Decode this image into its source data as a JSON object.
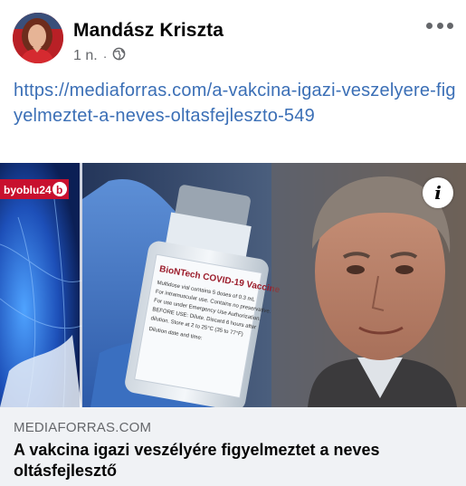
{
  "post": {
    "author": "Mandász Kriszta",
    "time": "1 n.",
    "separator": "·",
    "privacy_icon": "globe-icon",
    "link_text": "https://mediaforras.com/a-vakcina-igazi-veszelyere-figyelmeztet-a-neves-oltasfejleszto-549"
  },
  "link_preview": {
    "channel_logo": "byoblu24",
    "vial_label": [
      "BioNTech COVID-19 Vaccine",
      "Multidose vial contains 5 doses of 0.3 mL",
      "For intramuscular use. Contains no preservative.",
      "For use under Emergency Use Authorization.",
      "BEFORE USE: Dilute. Discard 6 hours after",
      "dilution. Store at 2 to 25°C (35 to 77°F)",
      "Dilution date and time:"
    ],
    "domain": "MEDIAFORRAS.COM",
    "headline": "A vakcina igazi veszélyére figyelmeztet a neves oltásfejlesztő"
  },
  "colors": {
    "link": "#3b6fb6",
    "secondary_text": "#65676b",
    "card_bg": "#f0f2f5"
  }
}
